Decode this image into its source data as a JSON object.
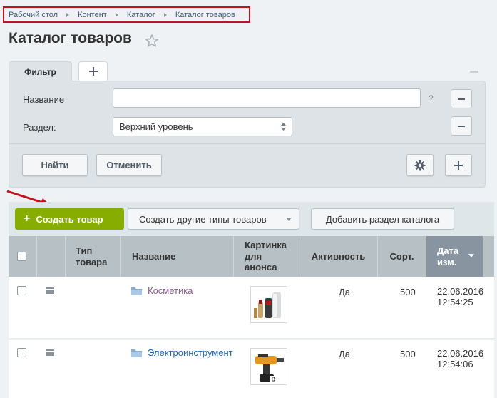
{
  "breadcrumb": [
    "Рабочий стол",
    "Контент",
    "Каталог",
    "Каталог товаров"
  ],
  "page_title": "Каталог товаров",
  "tabs": {
    "filter_label": "Фильтр",
    "add_label": "+"
  },
  "filter": {
    "name_label": "Название",
    "name_value": "",
    "help": "?",
    "section_label": "Раздел:",
    "section_value": "Верхний уровень",
    "find_label": "Найти",
    "cancel_label": "Отменить"
  },
  "toolbar": {
    "create_label": "Создать товар",
    "create_other_label": "Создать другие типы товаров",
    "add_section_label": "Добавить раздел каталога"
  },
  "columns": {
    "type": "Тип товара",
    "name": "Название",
    "picture": "Картинка для анонса",
    "active": "Активность",
    "sort": "Сорт.",
    "date": "Дата изм."
  },
  "rows": [
    {
      "name": "Косметика",
      "active": "Да",
      "sort": "500",
      "date": "22.06.2016",
      "time": "12:54:25",
      "icon": "cosmetics-thumbnail"
    },
    {
      "name": "Электроинструмент",
      "active": "Да",
      "sort": "500",
      "date": "22.06.2016",
      "time": "12:54:06",
      "icon": "drill-thumbnail"
    }
  ],
  "colors": {
    "accent_green": "#86ad00",
    "highlight": "#c0141a",
    "sorted_header": "#8895a0"
  }
}
